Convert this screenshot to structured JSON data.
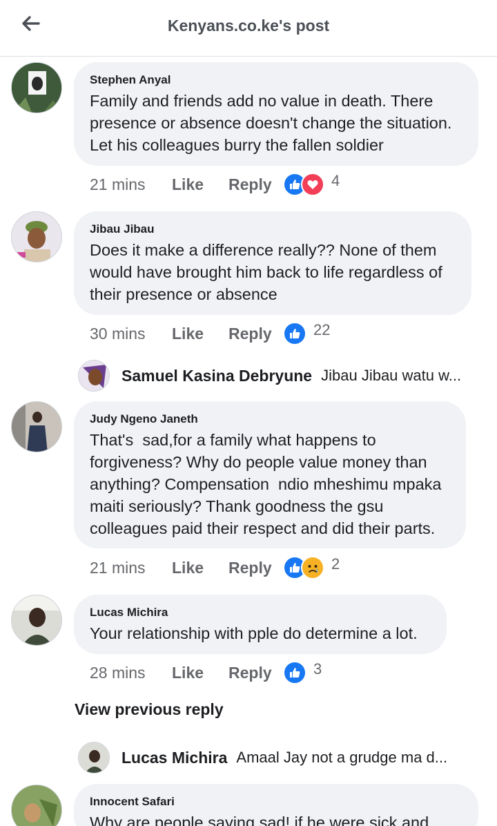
{
  "header": {
    "title": "Kenyans.co.ke's post",
    "back_icon": "arrow-left-icon"
  },
  "comments": [
    {
      "author": "Stephen Anyal",
      "text": "Family and friends add no value in death. There presence or absence doesn't change the situation. Let his colleagues burry the fallen soldier",
      "time": "21 mins",
      "like": "Like",
      "reply": "Reply",
      "reactions": [
        "like",
        "love"
      ],
      "reaction_count": "4"
    },
    {
      "author": "Jibau Jibau",
      "text": "Does it make a difference really?? None of them would have brought him back to life regardless of their presence or absence",
      "time": "30 mins",
      "like": "Like",
      "reply": "Reply",
      "reactions": [
        "like"
      ],
      "reaction_count": "22",
      "reply_preview": {
        "author": "Samuel Kasina Debryune",
        "text": "Jibau Jibau watu w..."
      }
    },
    {
      "author": "Judy Ngeno Janeth",
      "text": "That's  sad,for a family what happens to forgiveness? Why do people value money than anything? Compensation  ndio mheshimu mpaka maiti seriously? Thank goodness the gsu colleagues paid their respect and did their parts.",
      "time": "21 mins",
      "like": "Like",
      "reply": "Reply",
      "reactions": [
        "like",
        "sad"
      ],
      "reaction_count": "2"
    },
    {
      "author": "Lucas Michira",
      "text": "Your relationship with pple do determine a lot.",
      "time": "28 mins",
      "like": "Like",
      "reply": "Reply",
      "reactions": [
        "like"
      ],
      "reaction_count": "3",
      "view_previous": "View previous reply",
      "reply_preview": {
        "author": "Lucas Michira",
        "text": "Amaal Jay not a grudge ma d..."
      }
    },
    {
      "author": "Innocent Safari",
      "text": "Why are people saying sad! if he were sick and"
    }
  ],
  "colors": {
    "like_blue": "#1877f2",
    "love_red": "#f33e58",
    "sad_yellow": "#f7b125",
    "bubble": "#f0f2f5",
    "meta": "#65676b"
  }
}
